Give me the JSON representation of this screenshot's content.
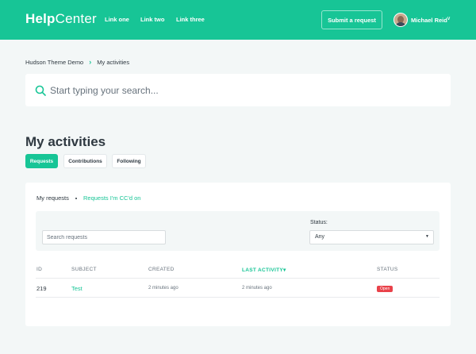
{
  "header": {
    "logo_bold": "Help",
    "logo_rest": "Center",
    "nav": [
      "Link one",
      "Link two",
      "Link three"
    ],
    "submit_label": "Submit a request",
    "user_name": "Michael Reid",
    "caret": "∨"
  },
  "breadcrumb": {
    "items": [
      "Hudson Theme Demo",
      "My activities"
    ],
    "separator": "›"
  },
  "search": {
    "placeholder": "Start typing your search..."
  },
  "page": {
    "title": "My activities",
    "tabs": [
      {
        "label": "Requests",
        "active": true
      },
      {
        "label": "Contributions",
        "active": false
      },
      {
        "label": "Following",
        "active": false
      }
    ]
  },
  "requests": {
    "subnav_active": "My requests",
    "subnav_link": "Requests I'm CC'd on",
    "filter_placeholder": "Search requests",
    "status_label": "Status:",
    "status_value": "Any",
    "columns": [
      "ID",
      "SUBJECT",
      "CREATED",
      "LAST ACTIVITY",
      "STATUS"
    ],
    "sort_indicator": "▾",
    "rows": [
      {
        "id": "219",
        "subject": "Test",
        "created": "2 minutes ago",
        "last_activity": "2 minutes ago",
        "status": "Open"
      }
    ]
  },
  "colors": {
    "brand": "#17c596",
    "background": "#f3f7f7",
    "status_open": "#e9424a"
  }
}
